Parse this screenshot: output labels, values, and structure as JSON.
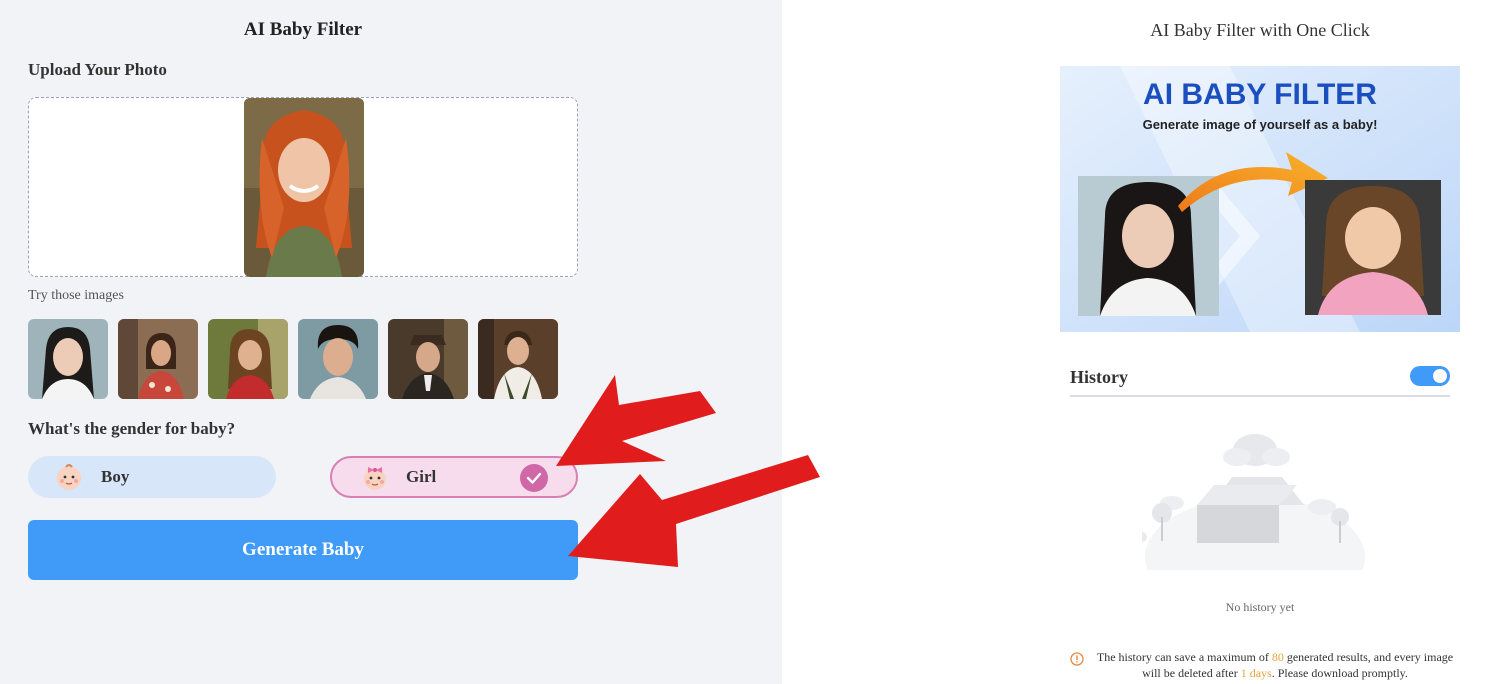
{
  "left_panel": {
    "title": "AI Baby Filter",
    "upload_label": "Upload Your Photo",
    "try_label": "Try those images",
    "gender_label": "What's the gender for baby?",
    "gender_options": {
      "boy": "Boy",
      "girl": "Girl"
    },
    "selected_gender": "Girl",
    "generate_label": "Generate Baby"
  },
  "right_panel": {
    "title": "AI Baby Filter with One Click",
    "banner": {
      "heading": "AI BABY FILTER",
      "subheading": "Generate image of yourself as a baby!"
    },
    "history": {
      "title": "History",
      "toggle_on": true,
      "empty_text": "No history yet"
    },
    "notice": {
      "part1": "The history can save a maximum of ",
      "max_results": "80",
      "part2": " generated results, and every image will be deleted after ",
      "days": "1 days",
      "part3": ". Please download promptly."
    }
  },
  "colors": {
    "accent_blue": "#3f9bf7",
    "girl_pink": "#d067a6",
    "boy_bg": "#d7e6f8",
    "girl_bg": "#f6dcec",
    "arrow_red": "#e01c1c",
    "notice_highlight": "#e8a33d"
  }
}
